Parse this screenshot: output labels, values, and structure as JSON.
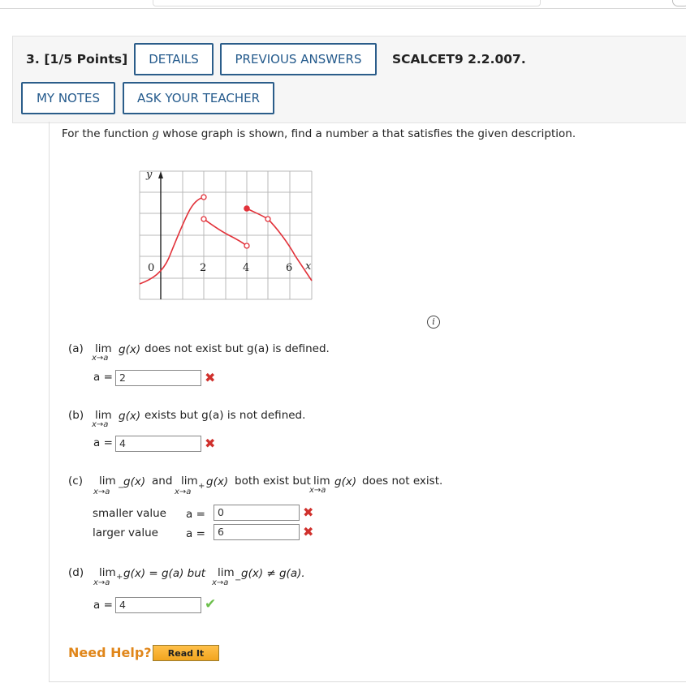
{
  "header": {
    "question_number": "3. [1/5 Points]",
    "details_label": "DETAILS",
    "previous_answers_label": "PREVIOUS ANSWERS",
    "code": "SCALCET9 2.2.007.",
    "my_notes_label": "MY NOTES",
    "ask_teacher_label": "ASK YOUR TEACHER"
  },
  "prompt": {
    "text_before": "For the function ",
    "func": "g",
    "text_after": " whose graph is shown, find a number a that satisfies the given description."
  },
  "graph": {
    "y_label": "y",
    "x_label": "x",
    "tick_labels": [
      "0",
      "2",
      "4",
      "6"
    ]
  },
  "info_icon_glyph": "i",
  "parts": {
    "a": {
      "label": "(a)",
      "lim": "lim",
      "sub": "x→a",
      "expr": "g(x)",
      "text": "does not exist but g(a) is defined.",
      "answer_prefix": "a =",
      "value": "2",
      "status": "incorrect"
    },
    "b": {
      "label": "(b)",
      "lim": "lim",
      "sub": "x→a",
      "expr": "g(x)",
      "text": "exists but g(a) is not defined.",
      "answer_prefix": "a =",
      "value": "4",
      "status": "incorrect"
    },
    "c": {
      "label": "(c)",
      "lim1": "lim",
      "sub1": "x→a",
      "sup1": "−",
      "expr1": "g(x)",
      "and": "and",
      "lim2": "lim",
      "sub2": "x→a",
      "sup2": "+",
      "expr2": "g(x)",
      "text1": "both exist but",
      "lim3": "lim",
      "sub3": "x→a",
      "expr3": "g(x)",
      "text2": "does not exist.",
      "smaller_label": "smaller value",
      "larger_label": "larger value",
      "answer_prefix": "a =",
      "smaller_value": "0",
      "larger_value": "6",
      "status": "incorrect"
    },
    "d": {
      "label": "(d)",
      "lim1": "lim",
      "sub1": "x→a",
      "sup1": "+",
      "expr1": "g(x) = g(a) but",
      "lim2": "lim",
      "sub2": "x→a",
      "sup2": "−",
      "expr2": "g(x) ≠ g(a).",
      "answer_prefix": "a =",
      "value": "4",
      "status": "correct"
    }
  },
  "help": {
    "need_help": "Need Help?",
    "read_it": "Read It"
  },
  "colors": {
    "button_border": "#2b5d8a",
    "curve": "#e2323a",
    "incorrect": "#d0312d",
    "correct": "#6cbf4b",
    "help": "#e0861a"
  }
}
